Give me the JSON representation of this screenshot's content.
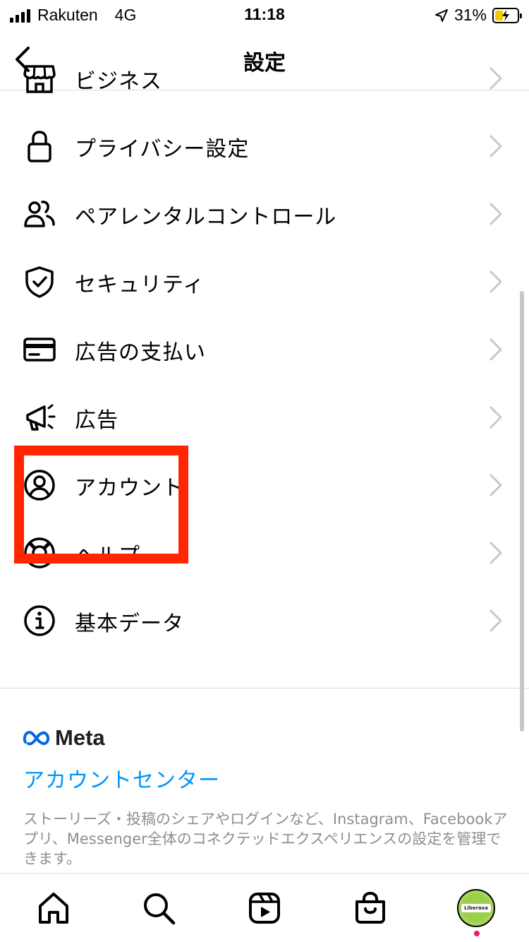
{
  "status_bar": {
    "carrier": "Rakuten",
    "network": "4G",
    "time": "11:18",
    "battery_percent": "31%",
    "battery_level": 0.31,
    "battery_color": "#f3c900"
  },
  "header": {
    "title": "設定",
    "back_icon": "chevron-left-icon"
  },
  "settings_items": [
    {
      "label": "ビジネス",
      "icon": "storefront-icon"
    },
    {
      "label": "プライバシー設定",
      "icon": "lock-icon"
    },
    {
      "label": "ペアレンタルコントロール",
      "icon": "people-icon"
    },
    {
      "label": "セキュリティ",
      "icon": "shield-check-icon"
    },
    {
      "label": "広告の支払い",
      "icon": "credit-card-icon"
    },
    {
      "label": "広告",
      "icon": "megaphone-icon"
    },
    {
      "label": "アカウント",
      "icon": "account-circle-icon"
    },
    {
      "label": "ヘルプ",
      "icon": "lifebuoy-icon"
    },
    {
      "label": "基本データ",
      "icon": "info-icon"
    }
  ],
  "meta": {
    "logo_text": "Meta",
    "account_center_label": "アカウントセンター",
    "description": "ストーリーズ・投稿のシェアやログインなど、Instagram、Facebookアプリ、Messenger全体のコネクテッドエクスペリエンスの設定を管理できます。",
    "link_color": "#0095f6"
  },
  "tab_bar": {
    "tabs": [
      "home-icon",
      "search-icon",
      "reels-icon",
      "shop-icon",
      "profile-avatar"
    ],
    "avatar_text": "Liberaxa",
    "notification_color": "#ed1c5b"
  },
  "highlight_color": "#ff2600"
}
